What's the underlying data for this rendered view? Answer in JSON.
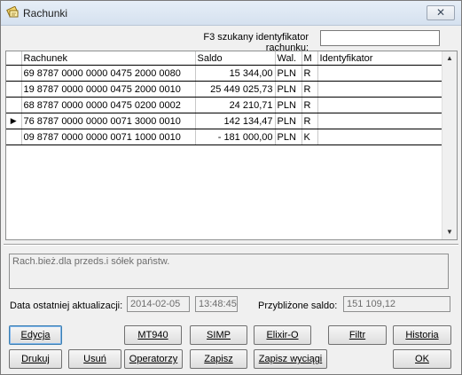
{
  "window": {
    "title": "Rachunki",
    "close_label": "✕"
  },
  "search": {
    "label": "F3 szukany identyfikator rachunku:",
    "value": ""
  },
  "table": {
    "columns": [
      "Rachunek",
      "Saldo",
      "Wal.",
      "M",
      "Identyfikator"
    ],
    "rows": [
      {
        "account": "69 8787 0000 0000 0475 2000 0080",
        "balance": "15 344,00",
        "currency": "PLN",
        "m": "R",
        "identifier": "",
        "current": false
      },
      {
        "account": "19 8787 0000 0000 0475 2000 0010",
        "balance": "25 449 025,73",
        "currency": "PLN",
        "m": "R",
        "identifier": "",
        "current": false
      },
      {
        "account": "68 8787 0000 0000 0475 0200 0002",
        "balance": "24 210,71",
        "currency": "PLN",
        "m": "R",
        "identifier": "",
        "current": false
      },
      {
        "account": "76 8787 0000 0000 0071 3000 0010",
        "balance": "142 134,47",
        "currency": "PLN",
        "m": "R",
        "identifier": "",
        "current": true
      },
      {
        "account": "09 8787 0000 0000 0071 1000 0010",
        "balance": "- 181 000,00",
        "currency": "PLN",
        "m": "K",
        "identifier": "",
        "current": false
      }
    ]
  },
  "description": "Rach.bież.dla przeds.i sółek państw.",
  "last_update": {
    "label": "Data ostatniej aktualizacji:",
    "date": "2014-02-05",
    "time": "13:48:45"
  },
  "approx_balance": {
    "label": "Przybliżone saldo:",
    "value": "151 109,12"
  },
  "buttons": {
    "edycja": "Edycja",
    "mt940": "MT940",
    "simp": "SIMP",
    "elixir": "Elixir-O",
    "filtr": "Filtr",
    "historia": "Historia",
    "drukuj": "Drukuj",
    "usun": "Usuń",
    "operatorzy": "Operatorzy",
    "zapisz": "Zapisz",
    "zapisz_wyciagi": "Zapisz wyciągi",
    "ok": "OK"
  }
}
